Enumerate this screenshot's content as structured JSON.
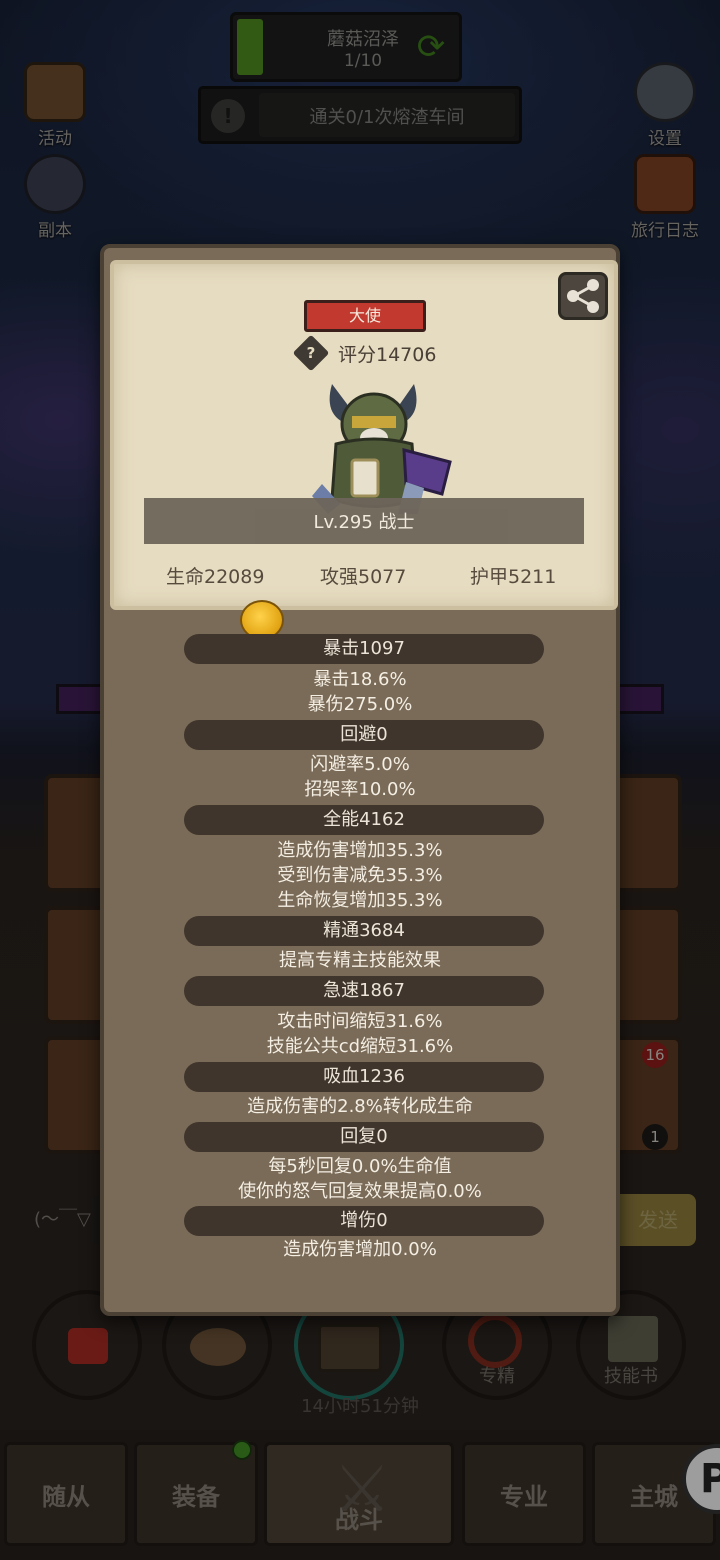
{
  "hud": {
    "stage_name": "蘑菇沼泽",
    "stage_progress": "1/10",
    "stage_progress_fraction": 0.1,
    "quest_text": "通关0/1次熔渣车间",
    "left_buttons": [
      {
        "label": "活动"
      },
      {
        "label": "副本"
      }
    ],
    "right_buttons": [
      {
        "label": "设置"
      },
      {
        "label": "旅行日志"
      }
    ]
  },
  "background": {
    "chat_placeholder": "(～￣▽",
    "send_label": "发送",
    "slot_badges": [
      "16",
      "1"
    ],
    "action_buttons": [
      {
        "label": ""
      },
      {
        "label": ""
      },
      {
        "label": "专精"
      },
      {
        "label": "技能书"
      }
    ],
    "timer": "14小时51分钟",
    "tabs": [
      {
        "label": "随从"
      },
      {
        "label": "装备"
      },
      {
        "label": "战斗"
      },
      {
        "label": "专业"
      },
      {
        "label": "主城"
      }
    ],
    "fab_glyph": "P"
  },
  "panel": {
    "title_badge": "大使",
    "score": "评分14706",
    "level_class": "Lv.295 战士",
    "hp": "生命22089",
    "attack": "攻强5077",
    "armor": "护甲5211",
    "stat_groups": [
      {
        "header": "暴击1097",
        "lines": [
          "暴击18.6%",
          "暴伤275.0%"
        ]
      },
      {
        "header": "回避0",
        "lines": [
          "闪避率5.0%",
          "招架率10.0%"
        ]
      },
      {
        "header": "全能4162",
        "lines": [
          "造成伤害增加35.3%",
          "受到伤害减免35.3%",
          "生命恢复增加35.3%"
        ]
      },
      {
        "header": "精通3684",
        "lines": [
          "提高专精主技能效果"
        ]
      },
      {
        "header": "急速1867",
        "lines": [
          "攻击时间缩短31.6%",
          "技能公共cd缩短31.6%"
        ]
      },
      {
        "header": "吸血1236",
        "lines": [
          "造成伤害的2.8%转化成生命"
        ]
      },
      {
        "header": "回复0",
        "lines": [
          "每5秒回复0.0%生命值",
          "使你的怒气回复效果提高0.0%"
        ]
      },
      {
        "header": "增伤0",
        "lines": [
          "造成伤害增加0.0%"
        ]
      }
    ]
  },
  "colors": {
    "badge_red": "#c23a2f",
    "parchment": "#e6dcc1",
    "panel_brown": "#7a6b58",
    "stat_header_bg": "#3f352c",
    "progress_green": "#4d8a1f"
  }
}
